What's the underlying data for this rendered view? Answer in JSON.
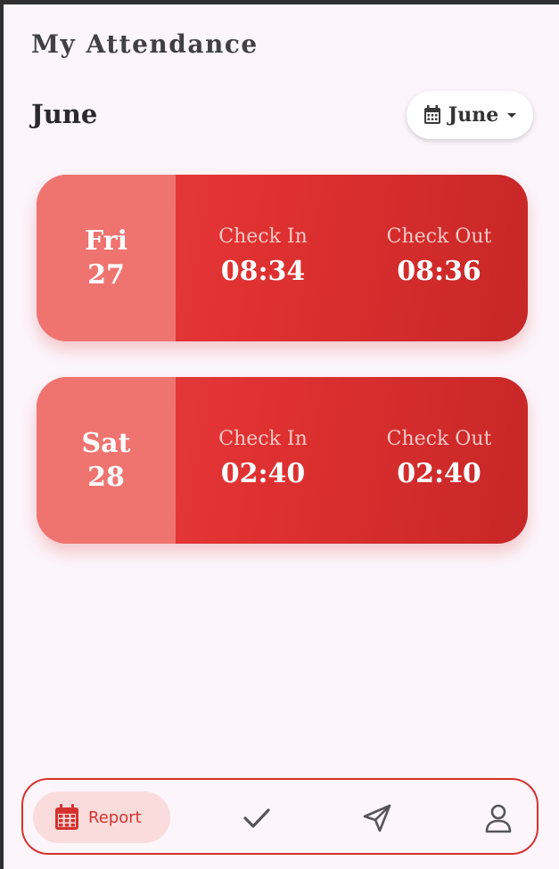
{
  "app": {
    "title": "My Attendance"
  },
  "month_heading": "June",
  "month_picker": {
    "label": "June",
    "icon": "calendar-icon"
  },
  "records": [
    {
      "day_name": "Fri",
      "day_num": "27",
      "check_in_label": "Check In",
      "check_in": "08:34",
      "check_out_label": "Check Out",
      "check_out": "08:36"
    },
    {
      "day_name": "Sat",
      "day_num": "28",
      "check_in_label": "Check In",
      "check_in": "02:40",
      "check_out_label": "Check Out",
      "check_out": "02:40"
    }
  ],
  "nav": {
    "report_label": "Report",
    "items": [
      "calendar-icon",
      "check-icon",
      "send-icon",
      "person-icon"
    ]
  },
  "colors": {
    "accent": "#d5322f",
    "card_start": "#e94040",
    "card_end": "#c72727",
    "day_panel": "#ef7470",
    "background": "#fcf6fb"
  }
}
